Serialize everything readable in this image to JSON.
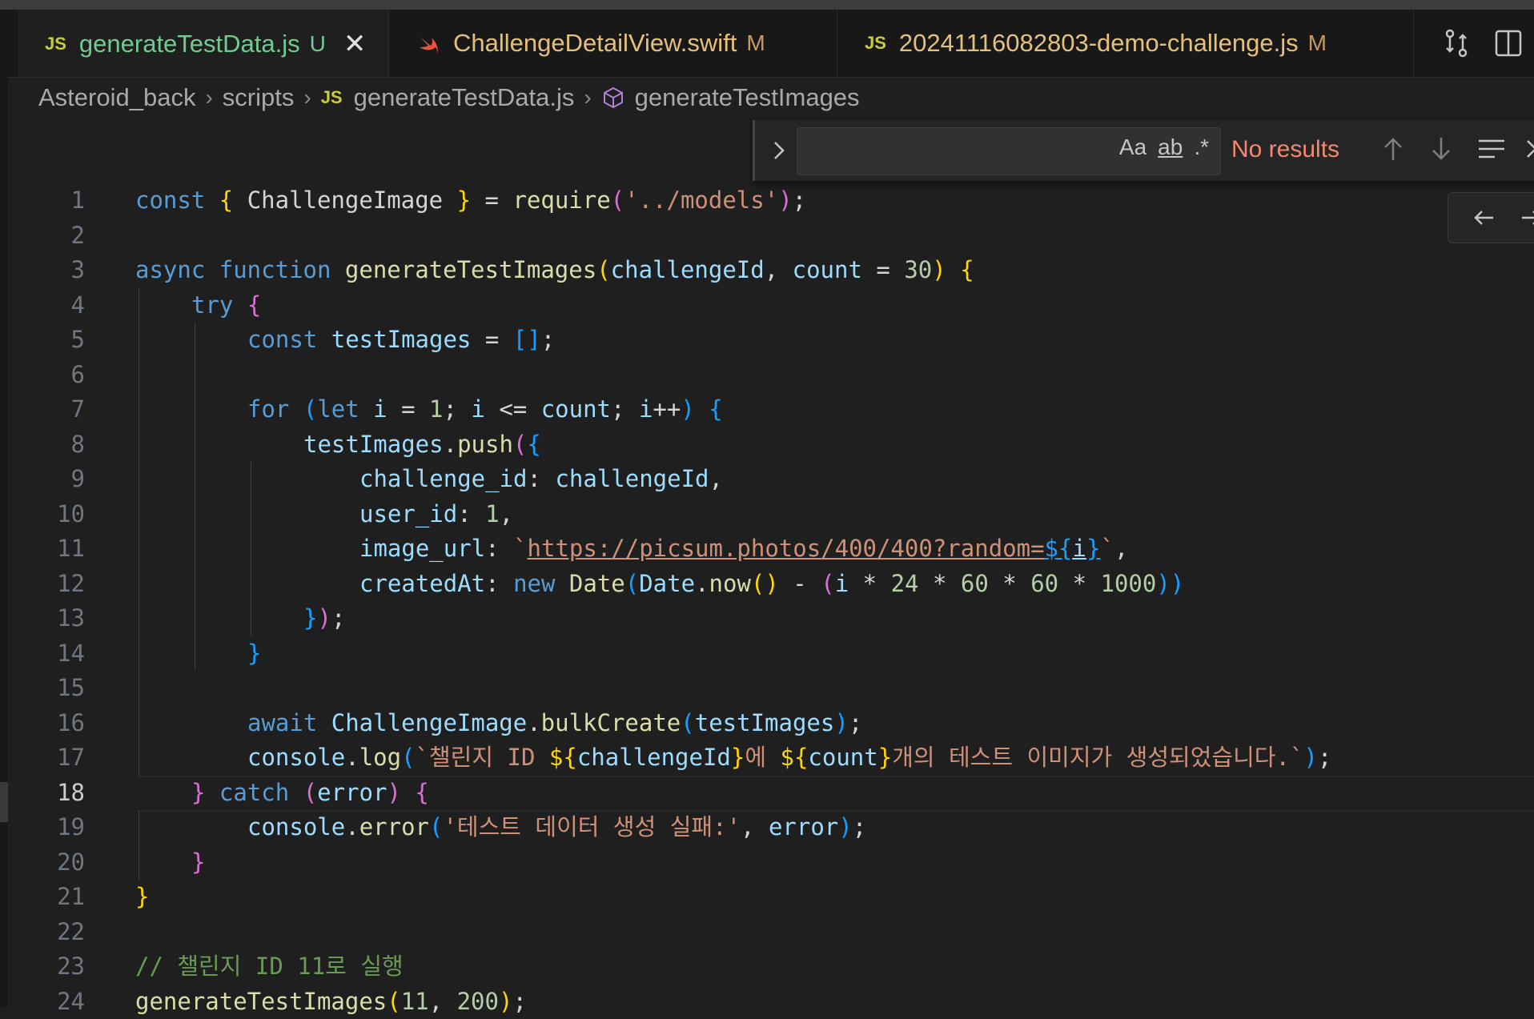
{
  "tabs": [
    {
      "icon": "JS",
      "name": "generateTestData.js",
      "flag": "U"
    },
    {
      "icon": "swift",
      "name": "ChallengeDetailView.swift",
      "flag": "M"
    },
    {
      "icon": "JS",
      "name": "20241116082803-demo-challenge.js",
      "flag": "M"
    },
    {
      "icon": "JS"
    }
  ],
  "breadcrumb": {
    "project": "Asteroid_back",
    "folder": "scripts",
    "file_icon": "JS",
    "file": "generateTestData.js",
    "symbol": "generateTestImages"
  },
  "find": {
    "value": "",
    "match_case": "Aa",
    "whole_word": "ab",
    "regex": ".*",
    "result": "No results"
  },
  "editor": {
    "current_line": 18,
    "lines": [
      {
        "n": "1",
        "t": [
          "const ",
          "{ ",
          "ChallengeImage ",
          "} ",
          "= ",
          "require",
          "(",
          "'../models'",
          ")",
          ";"
        ]
      },
      {
        "n": "2",
        "t": []
      },
      {
        "n": "3",
        "t": [
          "async ",
          "function ",
          "generateTestImages",
          "(",
          "challengeId",
          ", ",
          "count",
          " = ",
          "30",
          ") ",
          "{"
        ]
      },
      {
        "n": "4",
        "t": [
          "try ",
          "{"
        ]
      },
      {
        "n": "5",
        "t": [
          "const ",
          "testImages",
          " = ",
          "[]",
          ";"
        ]
      },
      {
        "n": "6",
        "t": []
      },
      {
        "n": "7",
        "t": [
          "for ",
          "(",
          "let ",
          "i",
          " = ",
          "1",
          "; ",
          "i",
          " <= ",
          "count",
          "; ",
          "i",
          "++",
          ") ",
          "{"
        ]
      },
      {
        "n": "8",
        "t": [
          "testImages",
          ".",
          "push",
          "(",
          "{"
        ]
      },
      {
        "n": "9",
        "t": [
          "challenge_id",
          ": ",
          "challengeId",
          ","
        ]
      },
      {
        "n": "10",
        "t": [
          "user_id",
          ": ",
          "1",
          ","
        ]
      },
      {
        "n": "11",
        "t": [
          "image_url",
          ": ",
          "`",
          "https://picsum.photos/400/400?random=",
          "${",
          "i",
          "}",
          "`",
          ","
        ]
      },
      {
        "n": "12",
        "t": [
          "createdAt",
          ": ",
          "new ",
          "Date",
          "(",
          "Date",
          ".",
          "now",
          "()",
          " - ",
          "(",
          "i",
          " * ",
          "24",
          " * ",
          "60",
          " * ",
          "60",
          " * ",
          "1000",
          "))"
        ]
      },
      {
        "n": "13",
        "t": [
          "}",
          ")",
          ";"
        ]
      },
      {
        "n": "14",
        "t": [
          "}"
        ]
      },
      {
        "n": "15",
        "t": []
      },
      {
        "n": "16",
        "t": [
          "await ",
          "ChallengeImage",
          ".",
          "bulkCreate",
          "(",
          "testImages",
          ")",
          ";"
        ]
      },
      {
        "n": "17",
        "t": [
          "console",
          ".",
          "log",
          "(",
          "`챌린지 ID ",
          "${",
          "challengeId",
          "}",
          "에 ",
          "${",
          "count",
          "}",
          "개의 테스트 이미지가 생성되었습니다.`",
          ")",
          ";"
        ]
      },
      {
        "n": "18",
        "t": [
          "} ",
          "catch ",
          "(",
          "error",
          ") ",
          "{"
        ]
      },
      {
        "n": "19",
        "t": [
          "console",
          ".",
          "error",
          "(",
          "'테스트 데이터 생성 실패:'",
          ", ",
          "error",
          ")",
          ";"
        ]
      },
      {
        "n": "20",
        "t": [
          "}"
        ]
      },
      {
        "n": "21",
        "t": [
          "}"
        ]
      },
      {
        "n": "22",
        "t": []
      },
      {
        "n": "23",
        "t": [
          "// 챌린지 ID 11로 실행"
        ]
      },
      {
        "n": "24",
        "t": [
          "generateTestImages",
          "(",
          "11",
          ", ",
          "200",
          ")",
          ";"
        ]
      }
    ]
  },
  "colors": {
    "keyword": "#569cd6",
    "function": "#dcdcaa",
    "string": "#ce9178",
    "number": "#b5cea8",
    "comment": "#6a9955",
    "modified": "#e5c07b",
    "untracked": "#73c991"
  }
}
